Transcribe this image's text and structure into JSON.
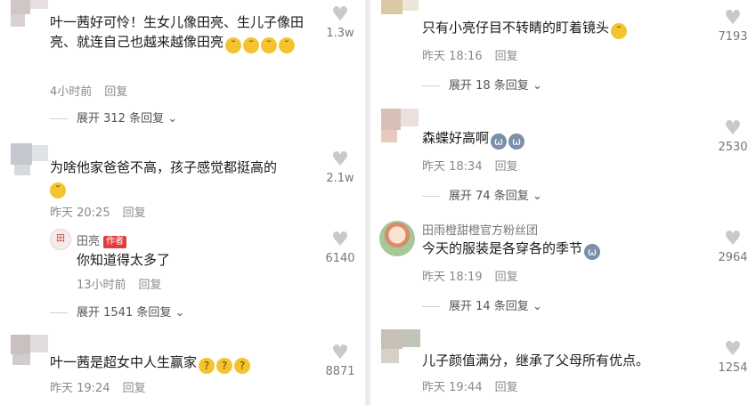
{
  "left": {
    "c1": {
      "text": "叶一茜好可怜！生女儿像田亮、生儿子像田亮、就连自己也越来越像田亮",
      "emojis": [
        "😂",
        "😂",
        "😂",
        "😂"
      ],
      "time": "4小时前",
      "reply": "回复",
      "expand": "展开 312 条回复",
      "likes": "1.3w"
    },
    "c2": {
      "text": "为啥他家爸爸不高，孩子感觉都挺高的",
      "emojis": [
        "😂"
      ],
      "time": "昨天 20:25",
      "reply": "回复",
      "likes": "2.1w",
      "sub": {
        "name": "田亮",
        "tag": "作者",
        "text": "你知道得太多了",
        "time": "13小时前",
        "reply": "回复",
        "likes": "6140"
      },
      "expand": "展开 1541 条回复"
    },
    "c3": {
      "text": "叶一茜是超女中人生赢家",
      "emojis": [
        "🤔",
        "🤔",
        "🤔"
      ],
      "time": "昨天 19:24",
      "reply": "回复",
      "likes": "8871"
    }
  },
  "right": {
    "c1": {
      "text": "只有小亮仔目不转睛的盯着镜头",
      "emojis": [
        "😂"
      ],
      "time": "昨天 18:16",
      "reply": "回复",
      "expand": "展开 18 条回复",
      "likes": "7193"
    },
    "c2": {
      "text": "森蝶好高啊",
      "emojis": [
        "🐱",
        "🐱"
      ],
      "time": "昨天 18:34",
      "reply": "回复",
      "expand": "展开 74 条回复",
      "likes": "2530"
    },
    "c3": {
      "name": "田雨橙甜橙官方粉丝团",
      "text": "今天的服装是各穿各的季节",
      "emojis": [
        "🐱"
      ],
      "time": "昨天 18:19",
      "reply": "回复",
      "expand": "展开 14 条回复",
      "likes": "2964"
    },
    "c4": {
      "text": "儿子颜值满分，继承了父母所有优点。",
      "time": "昨天 19:44",
      "reply": "回复",
      "likes": "1254"
    }
  },
  "icons": {
    "like": "heart-icon",
    "expand": "chevron-down-icon"
  },
  "colors": {
    "author_tag": "#e23d3d",
    "meta": "#8a8a8a",
    "text": "#1a1a1a"
  }
}
